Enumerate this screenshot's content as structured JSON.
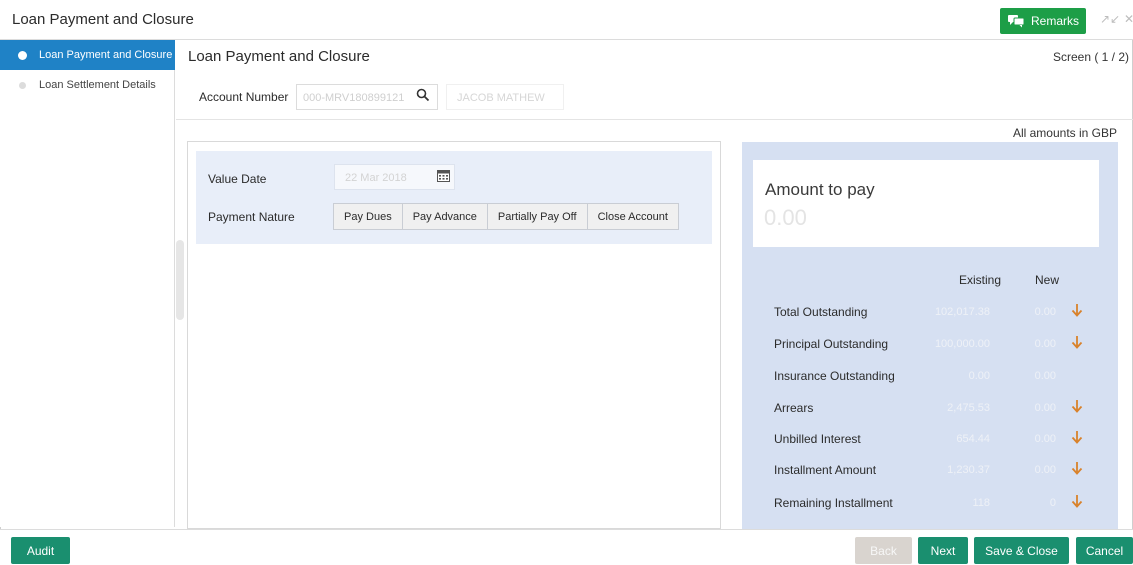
{
  "window": {
    "title": "Loan Payment and Closure",
    "remarks_label": "Remarks",
    "minimize_glyph": "↗↙",
    "close_glyph": "✕"
  },
  "sidebar": {
    "items": [
      {
        "label": "Loan Payment and Closure",
        "active": true
      },
      {
        "label": "Loan Settlement Details",
        "active": false
      }
    ]
  },
  "main": {
    "title": "Loan Payment and Closure",
    "screen_indicator": "Screen ( 1 / 2)",
    "account_label": "Account Number",
    "account_value": "000-MRV180899121",
    "account_name": "JACOB MATHEW",
    "amounts_note": "All amounts in GBP"
  },
  "form": {
    "value_date_label": "Value Date",
    "value_date_value": "22 Mar 2018",
    "payment_nature_label": "Payment Nature",
    "payment_options": [
      "Pay Dues",
      "Pay Advance",
      "Partially Pay Off",
      "Close Account"
    ]
  },
  "summary": {
    "amount_to_pay_label": "Amount to pay",
    "amount_to_pay_value": "0.00",
    "col_existing": "Existing",
    "col_new": "New",
    "rows": [
      {
        "label": "Total Outstanding",
        "existing": "102,017.38",
        "new": "0.00",
        "arrow": true
      },
      {
        "label": "Principal Outstanding",
        "existing": "100,000.00",
        "new": "0.00",
        "arrow": true
      },
      {
        "label": "Insurance Outstanding",
        "existing": "0.00",
        "new": "0.00",
        "arrow": false
      },
      {
        "label": "Arrears",
        "existing": "2,475.53",
        "new": "0.00",
        "arrow": true
      },
      {
        "label": "Unbilled Interest",
        "existing": "654.44",
        "new": "0.00",
        "arrow": true
      },
      {
        "label": "Installment Amount",
        "existing": "1,230.37",
        "new": "0.00",
        "arrow": true
      },
      {
        "label": "Remaining Installment",
        "existing": "118",
        "new": "0",
        "arrow": true
      }
    ]
  },
  "footer": {
    "audit": "Audit",
    "back": "Back",
    "next": "Next",
    "save_close": "Save & Close",
    "cancel": "Cancel"
  },
  "colors": {
    "accent_blue": "#1f82c6",
    "action_green": "#1a8f6f",
    "arrow_orange": "#d9822b"
  }
}
